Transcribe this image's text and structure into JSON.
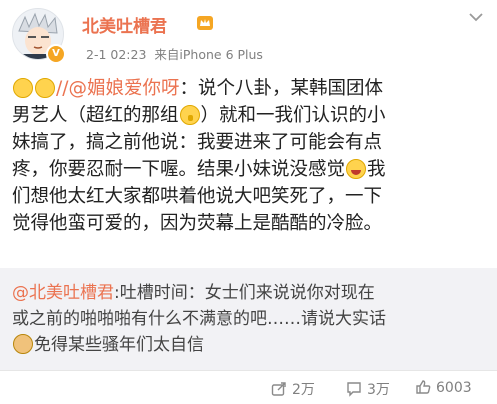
{
  "post": {
    "username": "北美吐槽君",
    "timestamp": "2-1 02:23",
    "source": "来自iPhone 6 Plus",
    "body_lines": [
      {
        "mention": "//@媚娘爱你呀",
        "text": "：说个八卦，某韩国团体"
      },
      {
        "text": "男艺人（超红的那组",
        "after": "）就和一我们认识的小"
      },
      {
        "text": "妹搞了，搞之前他说：我要进来了可能会有点"
      },
      {
        "text": "疼，你要忍耐一下喔。结果小妹说没感觉",
        "after": "我"
      },
      {
        "text": "们想他太红大家都哄着他说大吧笑死了，一下"
      },
      {
        "text": "觉得他蛮可爱的，因为荧幕上是酷酷的冷脸。"
      }
    ]
  },
  "repost": {
    "mention": "@北美吐槽君",
    "line1": ":吐槽时间：女士们来说说你对现在",
    "line2": "或之前的啪啪啪有什么不满意的吧……请说大实话",
    "line3": "免得某些骚年们太自信"
  },
  "footer": {
    "share_count": "2万",
    "comment_count": "3万",
    "like_count": "6003"
  },
  "colors": {
    "accent": "#eb7350",
    "meta": "#808080",
    "repost_bg": "#f2f2f5"
  },
  "icons": [
    "avatar-image",
    "vip-crown-icon",
    "dropdown-chevron-icon",
    "emoji-pray",
    "emoji-shush",
    "emoji-laugh",
    "emoji-dog",
    "share-icon",
    "comment-icon",
    "like-icon"
  ]
}
